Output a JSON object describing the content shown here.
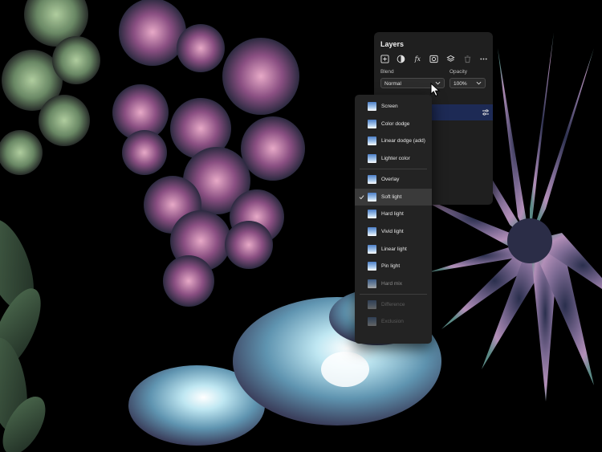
{
  "layers_panel": {
    "title": "Layers",
    "toolbar_icons": [
      "add-layer-icon",
      "mask-icon",
      "fx-icon",
      "layer-mask-icon",
      "stack-icon",
      "delete-icon",
      "more-icon"
    ],
    "fx_label": "fx",
    "blend_label": "Blend",
    "blend_value": "Normal",
    "opacity_label": "Opacity",
    "opacity_value": "100%"
  },
  "blend_dropdown": {
    "options": [
      {
        "label": "Screen"
      },
      {
        "label": "Color dodge"
      },
      {
        "label": "Linear dodge (add)"
      },
      {
        "label": "Lighter color"
      },
      {
        "label": "Overlay"
      },
      {
        "label": "Soft light",
        "selected": true
      },
      {
        "label": "Hard light"
      },
      {
        "label": "Vivid light"
      },
      {
        "label": "Linear light"
      },
      {
        "label": "Pin light"
      },
      {
        "label": "Hard mix"
      },
      {
        "label": "Difference"
      },
      {
        "label": "Exclusion"
      }
    ]
  },
  "colors": {
    "panel_bg": "#1f1f1f",
    "selected_layer": "#1d2a55",
    "dropdown_bg": "#232323",
    "canvas_bg": "#000000"
  }
}
